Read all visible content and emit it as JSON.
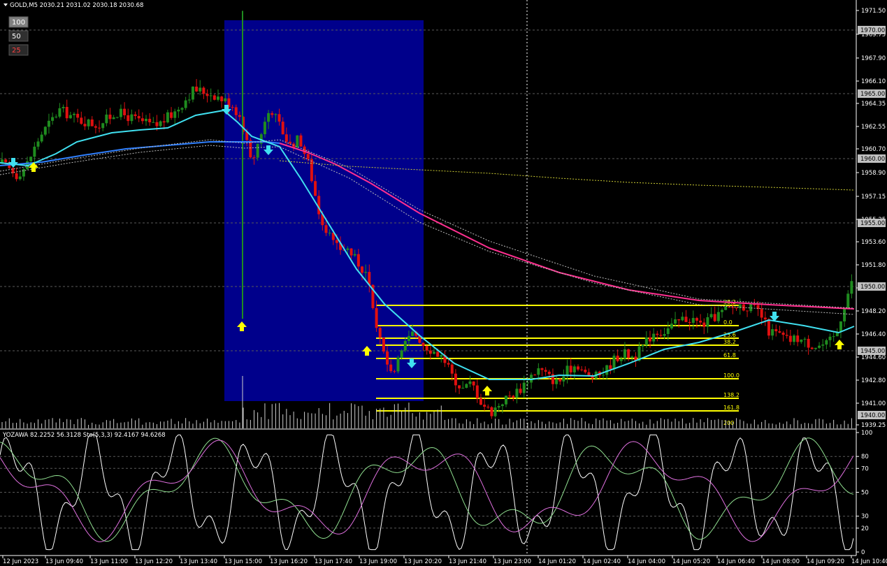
{
  "header": {
    "symbol": "GOLD,M5",
    "ohlc": "2030.21 2031.02 2030.18 2030.68"
  },
  "level_buttons": [
    {
      "label": "100",
      "bg": "#808080"
    },
    {
      "label": "50",
      "bg": "#303030"
    },
    {
      "label": "25",
      "bg": "#2a2a2a",
      "color": "#ff4040"
    }
  ],
  "indicator_header": "YOZAWA 82.2252 56.3128  Sto(5,3,3) 92.4167 94.6268",
  "price_axis": {
    "ticks": [
      "1971.50",
      "1969.75",
      "1967.90",
      "1966.10",
      "1964.35",
      "1962.55",
      "1960.70",
      "1958.90",
      "1957.15",
      "1955.25",
      "1953.60",
      "1951.80",
      "1950.00",
      "1948.20",
      "1946.40",
      "1944.60",
      "1942.80",
      "1941.00",
      "1939.25"
    ],
    "boxed": [
      "1970.00",
      "1965.00",
      "1960.00",
      "1955.00",
      "1950.00",
      "1945.00",
      "1940.00"
    ]
  },
  "sub_axis": {
    "ticks": [
      "100",
      "80",
      "70",
      "50",
      "30",
      "20",
      "0"
    ]
  },
  "time_axis": {
    "labels": [
      "12 Jun 2023",
      "13 Jun 09:40",
      "13 Jun 11:00",
      "13 Jun 12:20",
      "13 Jun 13:40",
      "13 Jun 15:00",
      "13 Jun 16:20",
      "13 Jun 17:40",
      "13 Jun 19:00",
      "13 Jun 20:20",
      "13 Jun 21:40",
      "13 Jun 23:00",
      "14 Jun 01:20",
      "14 Jun 02:40",
      "14 Jun 04:00",
      "14 Jun 05:20",
      "14 Jun 06:40",
      "14 Jun 08:00",
      "14 Jun 09:20",
      "14 Jun 10:40"
    ]
  },
  "fib_levels": [
    "38.2",
    "0.0",
    "23.6",
    "38.2",
    "61.8",
    "100.0",
    "138.2",
    "161.8",
    "200"
  ],
  "colors": {
    "bull": "#1f8c1f",
    "bear": "#e01010",
    "ma_fast": "#40e0f0",
    "ma_mid": "#3080ff",
    "ma_slow": "#ff3090",
    "fib": "#ffff00",
    "stoch_main": "#90e090",
    "stoch_signal": "#e070e0",
    "oscillator": "#ffffff",
    "box": "#00008b"
  },
  "chart_data": {
    "type": "candlestick",
    "symbol": "GOLD",
    "timeframe": "M5",
    "y_range": [
      1939.25,
      1972.0
    ],
    "sub_range": [
      0,
      100
    ],
    "approx_close_path": [
      [
        0,
        1959.6
      ],
      [
        3,
        1958.7
      ],
      [
        5,
        1959.4
      ],
      [
        8,
        1961.8
      ],
      [
        12,
        1963.8
      ],
      [
        16,
        1963.0
      ],
      [
        20,
        1962.6
      ],
      [
        24,
        1963.6
      ],
      [
        28,
        1963.0
      ],
      [
        32,
        1962.5
      ],
      [
        36,
        1963.6
      ],
      [
        40,
        1965.4
      ],
      [
        44,
        1965.0
      ],
      [
        48,
        1964.2
      ],
      [
        50,
        1963.0
      ],
      [
        52,
        1959.5
      ],
      [
        54,
        1962.0
      ],
      [
        56,
        1964.0
      ],
      [
        58,
        1962.5
      ],
      [
        60,
        1961.0
      ],
      [
        62,
        1961.6
      ],
      [
        64,
        1959.5
      ],
      [
        66,
        1956.0
      ],
      [
        68,
        1954.0
      ],
      [
        70,
        1953.0
      ],
      [
        72,
        1953.0
      ],
      [
        74,
        1952.0
      ],
      [
        76,
        1951.0
      ],
      [
        78,
        1947.0
      ],
      [
        80,
        1944.0
      ],
      [
        82,
        1943.5
      ],
      [
        84,
        1945.5
      ],
      [
        86,
        1946.5
      ],
      [
        88,
        1945.5
      ],
      [
        90,
        1945.0
      ],
      [
        92,
        1944.5
      ],
      [
        94,
        1943.0
      ],
      [
        96,
        1942.0
      ],
      [
        98,
        1942.5
      ],
      [
        100,
        1941.0
      ],
      [
        102,
        1940.2
      ],
      [
        104,
        1941.0
      ],
      [
        106,
        1941.5
      ],
      [
        108,
        1942.0
      ],
      [
        110,
        1943.0
      ],
      [
        112,
        1943.6
      ],
      [
        114,
        1943.0
      ],
      [
        116,
        1942.5
      ],
      [
        118,
        1943.5
      ],
      [
        120,
        1944.0
      ],
      [
        122,
        1943.0
      ],
      [
        124,
        1943.0
      ],
      [
        126,
        1943.5
      ],
      [
        128,
        1944.5
      ],
      [
        130,
        1944.8
      ],
      [
        132,
        1944.5
      ],
      [
        134,
        1945.5
      ],
      [
        136,
        1946.5
      ],
      [
        138,
        1946.5
      ],
      [
        140,
        1947.0
      ],
      [
        142,
        1947.5
      ],
      [
        144,
        1947.5
      ],
      [
        146,
        1947.0
      ],
      [
        148,
        1947.5
      ],
      [
        150,
        1948.0
      ],
      [
        152,
        1948.3
      ],
      [
        154,
        1948.6
      ],
      [
        156,
        1948.4
      ],
      [
        158,
        1948.0
      ],
      [
        160,
        1946.5
      ],
      [
        162,
        1946.3
      ],
      [
        164,
        1945.8
      ],
      [
        166,
        1946.0
      ],
      [
        168,
        1945.6
      ],
      [
        170,
        1945.4
      ],
      [
        172,
        1945.5
      ],
      [
        174,
        1946.2
      ],
      [
        176,
        1949.0
      ],
      [
        178,
        1951.0
      ]
    ]
  }
}
